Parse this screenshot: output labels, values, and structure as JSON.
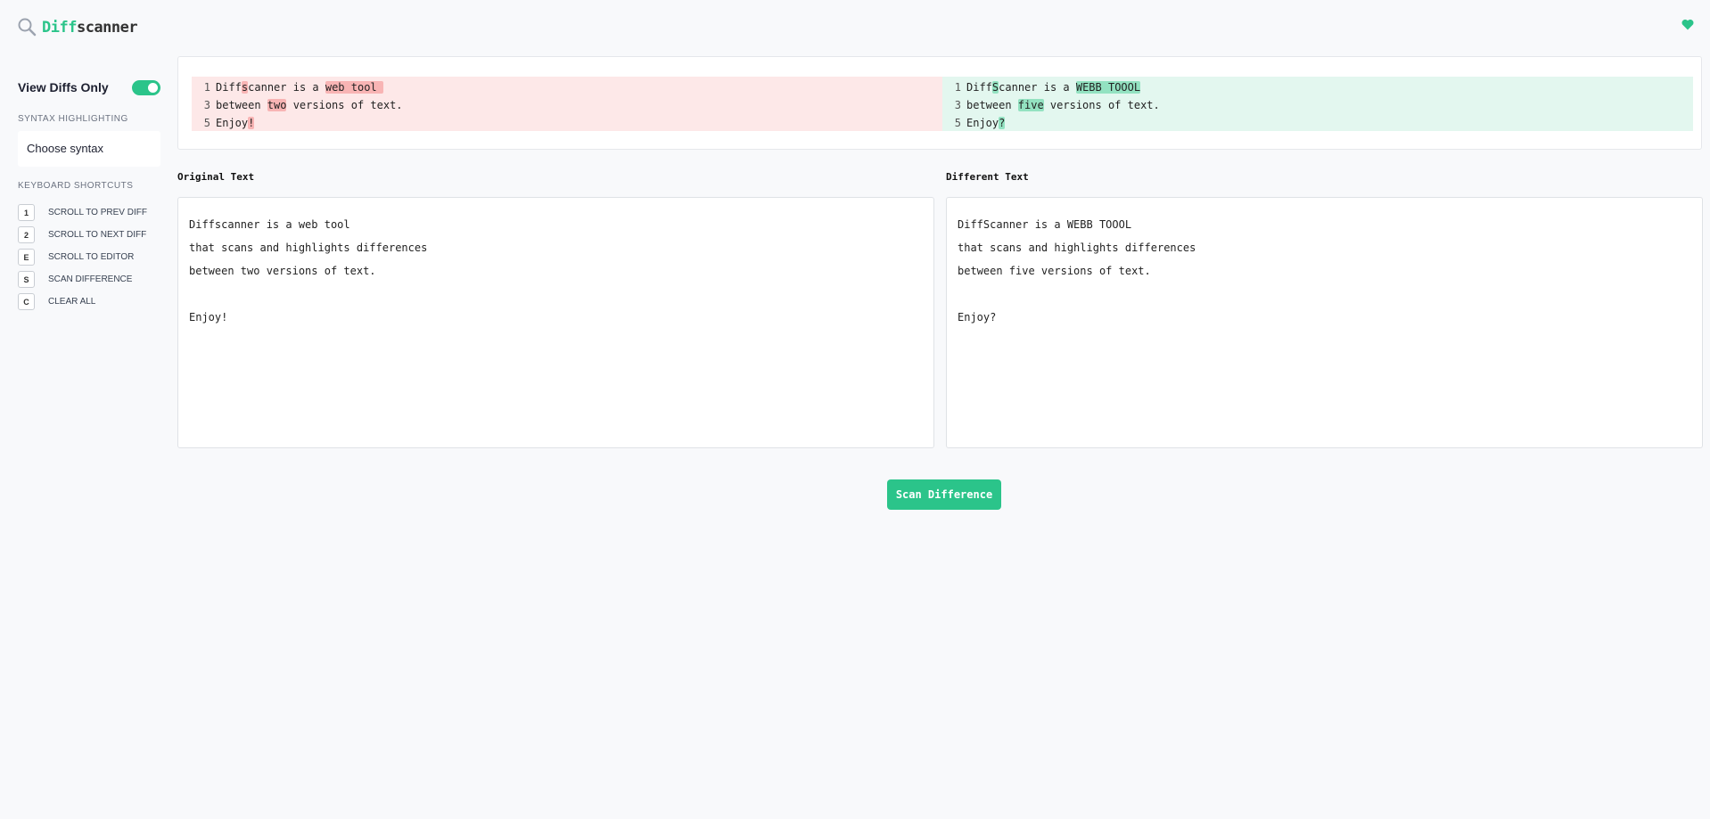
{
  "app": {
    "logo_part1": "Diff",
    "logo_part2": "scanner",
    "accent_color": "#2bc48a",
    "delete_color": "#f8b4b4",
    "add_color": "#93e2c1"
  },
  "sidebar": {
    "view_diffs_label": "View Diffs Only",
    "view_diffs_enabled": true,
    "syntax_section_title": "SYNTAX HIGHLIGHTING",
    "syntax_placeholder": "Choose syntax",
    "shortcuts_section_title": "KEYBOARD SHORTCUTS",
    "shortcuts": [
      {
        "key": "1",
        "label": "SCROLL TO PREV DIFF"
      },
      {
        "key": "2",
        "label": "SCROLL TO NEXT DIFF"
      },
      {
        "key": "E",
        "label": "SCROLL TO EDITOR"
      },
      {
        "key": "S",
        "label": "SCAN DIFFERENCE"
      },
      {
        "key": "C",
        "label": "CLEAR ALL"
      }
    ]
  },
  "diff": {
    "left": [
      {
        "num": "1",
        "segments": [
          {
            "t": "Diff"
          },
          {
            "t": "s",
            "hl": true
          },
          {
            "t": "canner is a "
          },
          {
            "t": "web tool ",
            "hl": true
          }
        ]
      },
      {
        "num": "3",
        "segments": [
          {
            "t": "between "
          },
          {
            "t": "two",
            "hl": true
          },
          {
            "t": " versions of text."
          }
        ]
      },
      {
        "num": "5",
        "segments": [
          {
            "t": "Enjoy"
          },
          {
            "t": "!",
            "hl": true
          }
        ]
      }
    ],
    "right": [
      {
        "num": "1",
        "segments": [
          {
            "t": "Diff"
          },
          {
            "t": "S",
            "hl": true
          },
          {
            "t": "canner is a "
          },
          {
            "t": "WEBB TOOOL",
            "hl": true
          }
        ]
      },
      {
        "num": "3",
        "segments": [
          {
            "t": "between "
          },
          {
            "t": "five",
            "hl": true
          },
          {
            "t": " versions of text."
          }
        ]
      },
      {
        "num": "5",
        "segments": [
          {
            "t": "Enjoy"
          },
          {
            "t": "?",
            "hl": true
          }
        ]
      }
    ]
  },
  "editors": {
    "original_label": "Original Text",
    "different_label": "Different Text",
    "original_lines": [
      "Diffscanner is a web tool",
      "that scans and highlights differences",
      "between two versions of text.",
      "",
      "Enjoy!"
    ],
    "different_lines": [
      "DiffScanner is a WEBB TOOOL",
      "that scans and highlights differences",
      "between five versions of text.",
      "",
      "Enjoy?"
    ]
  },
  "scan_button_label": "Scan Difference"
}
